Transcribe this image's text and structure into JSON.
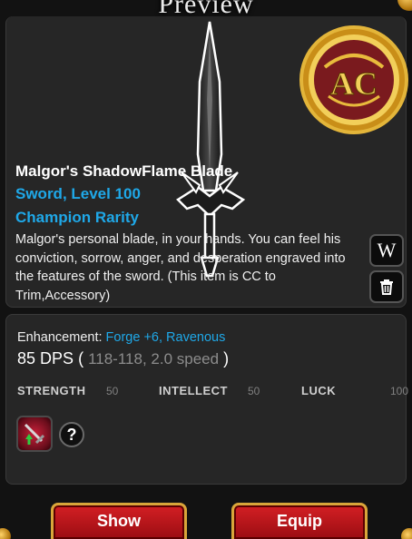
{
  "window": {
    "title": "Preview"
  },
  "item": {
    "name": "Malgor's ShadowFlame Blade",
    "type_level": "Sword, Level 100",
    "rarity": "Champion Rarity",
    "description": "Malgor's personal blade, in your hands. You can feel his conviction, sorrow, anger, and desperation engraved into the features of the sword. (This item is CC to Trim,Accessory)",
    "badge_text": "AC"
  },
  "side_buttons": {
    "wiki_label": "W"
  },
  "stats": {
    "enhancement_label": "Enhancement:",
    "enhancement_value": "Forge +6, Ravenous",
    "dps_value": "85 DPS",
    "dps_open": "(",
    "dps_detail": "118-118, 2.0 speed",
    "dps_close": ")",
    "attributes": [
      {
        "label": "STRENGTH",
        "value": "50"
      },
      {
        "label": "INTELLECT",
        "value": "50"
      },
      {
        "label": "LUCK",
        "value": "100"
      }
    ],
    "help_label": "?"
  },
  "actions": {
    "show_label": "Show",
    "equip_label": "Equip"
  },
  "colors": {
    "accent_blue": "#1fa8e8",
    "button_red": "#c41a1f",
    "gold_trim": "#d9a63a",
    "panel_bg": "#262626"
  },
  "icons": {
    "wiki": "wiki-w-icon",
    "delete": "trash-icon",
    "enhancement": "sword-enhancement-icon",
    "help": "question-mark-icon",
    "badge": "ac-gold-badge-icon"
  }
}
